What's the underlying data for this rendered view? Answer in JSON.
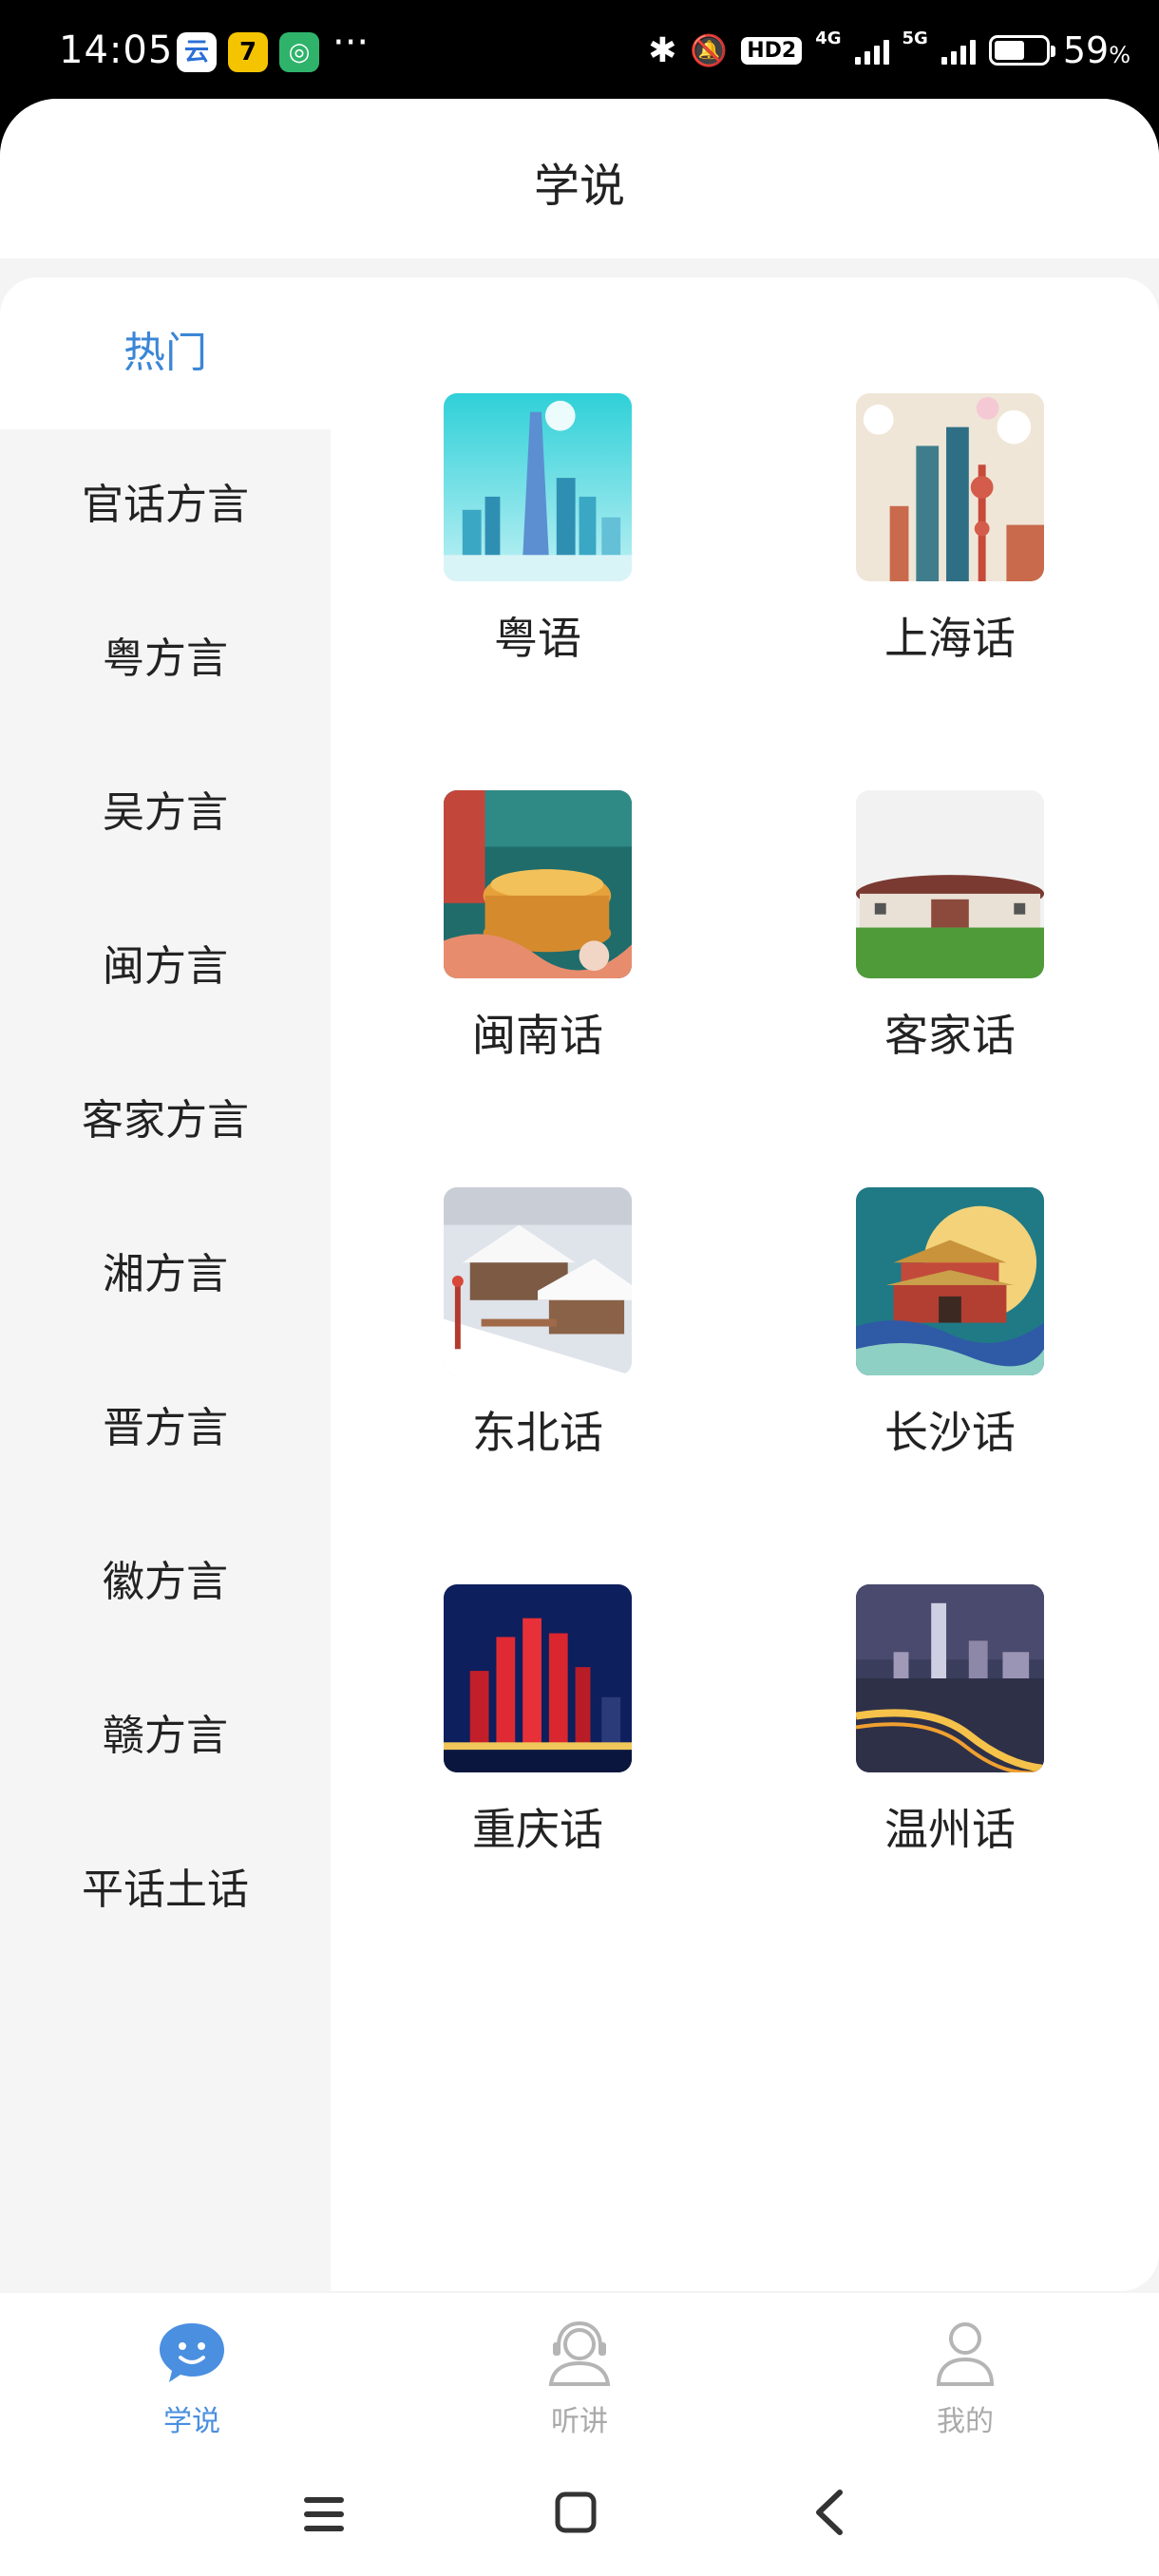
{
  "status_bar": {
    "time": "14:05",
    "network_4g": "4G",
    "network_5g": "5G",
    "hd": "HD2",
    "battery_percent": "59",
    "battery_unit": "%",
    "more": "···",
    "battery_level": 0.59
  },
  "header": {
    "title": "学说"
  },
  "sidebar": {
    "items": [
      {
        "label": "热门",
        "active": true
      },
      {
        "label": "官话方言"
      },
      {
        "label": "粤方言"
      },
      {
        "label": "吴方言"
      },
      {
        "label": "闽方言"
      },
      {
        "label": "客家方言"
      },
      {
        "label": "湘方言"
      },
      {
        "label": "晋方言"
      },
      {
        "label": "徽方言"
      },
      {
        "label": "赣方言"
      },
      {
        "label": "平话土话"
      }
    ]
  },
  "dialects": [
    {
      "label": "粤语",
      "image": "guangzhou-tower-skyline"
    },
    {
      "label": "上海话",
      "image": "shanghai-skyline-magnolia"
    },
    {
      "label": "闽南话",
      "image": "tulou-illustration"
    },
    {
      "label": "客家话",
      "image": "hakka-tulou-building"
    },
    {
      "label": "东北话",
      "image": "snowy-village"
    },
    {
      "label": "长沙话",
      "image": "changsha-pavilion-illustration"
    },
    {
      "label": "重庆话",
      "image": "chongqing-night-towers"
    },
    {
      "label": "温州话",
      "image": "wenzhou-night-city"
    }
  ],
  "tabbar": {
    "tabs": [
      {
        "label": "学说",
        "icon": "chat-bubble-face-icon",
        "active": true
      },
      {
        "label": "听讲",
        "icon": "headset-user-icon"
      },
      {
        "label": "我的",
        "icon": "profile-icon"
      }
    ]
  },
  "colors": {
    "accent": "#3b86d6",
    "tab_active": "#4a8fe0",
    "sidebar_bg": "#f5f5f5"
  }
}
